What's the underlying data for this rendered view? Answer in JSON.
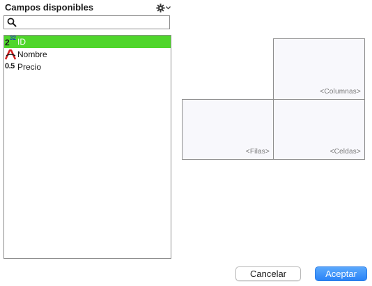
{
  "panel": {
    "title": "Campos disponibles",
    "settings_icon": "gear-icon",
    "search": {
      "value": "",
      "placeholder": "",
      "icon": "search-icon"
    }
  },
  "fields": [
    {
      "label": "ID",
      "icon": "integer-type-icon",
      "icon_text_big": "2",
      "icon_text_small": "32",
      "selected": true
    },
    {
      "label": "Nombre",
      "icon": "text-type-icon",
      "selected": false
    },
    {
      "label": "Precio",
      "icon": "decimal-type-icon",
      "icon_text_big": "0.5",
      "selected": false
    }
  ],
  "pivot": {
    "columns_label": "<Columnas>",
    "rows_label": "<Filas>",
    "cells_label": "<Celdas>"
  },
  "buttons": {
    "cancel": "Cancelar",
    "accept": "Aceptar"
  },
  "colors": {
    "selection": "#4fd62b",
    "accent": "#2a84f7",
    "zone_background": "#f8f8fc"
  }
}
